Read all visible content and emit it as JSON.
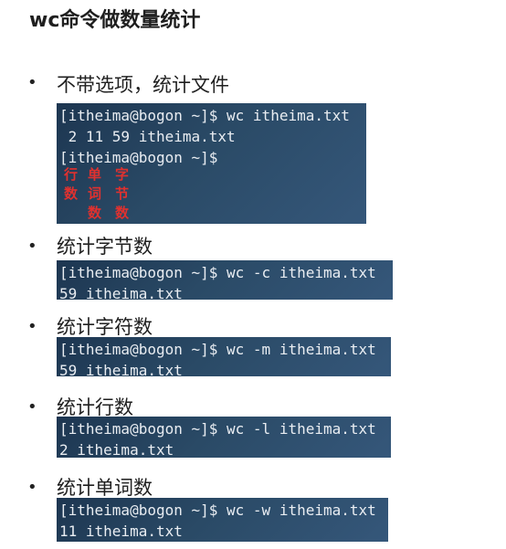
{
  "title": "wc命令做数量统计",
  "bullet": "•",
  "items": [
    {
      "label": "不带选项，统计文件",
      "lines": [
        "[itheima@bogon ~]$ wc itheima.txt",
        " 2 11 59 itheima.txt",
        "[itheima@bogon ~]$"
      ],
      "annotations": [
        [
          "行",
          "数"
        ],
        [
          "单",
          "词",
          "数"
        ],
        [
          "字",
          "节",
          "数"
        ]
      ]
    },
    {
      "label": "统计字节数",
      "lines": [
        "[itheima@bogon ~]$ wc -c itheima.txt",
        "59 itheima.txt"
      ]
    },
    {
      "label": "统计字符数",
      "lines": [
        "[itheima@bogon ~]$ wc -m itheima.txt",
        "59 itheima.txt"
      ]
    },
    {
      "label": "统计行数",
      "lines": [
        "[itheima@bogon ~]$ wc -l itheima.txt",
        "2 itheima.txt"
      ]
    },
    {
      "label": "统计单词数",
      "lines": [
        "[itheima@bogon ~]$ wc -w itheima.txt",
        "11 itheima.txt"
      ]
    }
  ],
  "colors": {
    "annotation": "#e0312f",
    "terminal_text": "#e9edf2"
  }
}
